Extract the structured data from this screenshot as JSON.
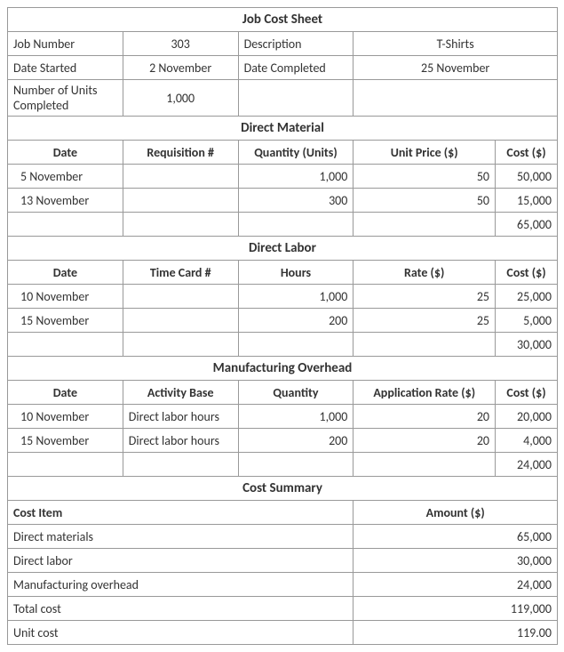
{
  "title": "Job Cost Sheet",
  "info": {
    "jobNumberLabel": "Job Number",
    "jobNumber": "303",
    "descriptionLabel": "Description",
    "description": "T-Shirts",
    "dateStartedLabel": "Date Started",
    "dateStarted": "2 November",
    "dateCompletedLabel": "Date Completed",
    "dateCompleted": "25 November",
    "unitsLabel": "Number of Units Completed",
    "units": "1,000"
  },
  "dm": {
    "heading": "Direct Material",
    "h": {
      "date": "Date",
      "req": "Requisition #",
      "qty": "Quantity (Units)",
      "price": "Unit  Price ($)",
      "cost": "Cost ($)"
    },
    "rows": [
      {
        "date": "5 November",
        "req": "",
        "qty": "1,000",
        "price": "50",
        "cost": "50,000"
      },
      {
        "date": "13 November",
        "req": "",
        "qty": "300",
        "price": "50",
        "cost": "15,000"
      }
    ],
    "total": {
      "cost": "65,000"
    }
  },
  "dl": {
    "heading": "Direct Labor",
    "h": {
      "date": "Date",
      "tc": "Time Card #",
      "hours": "Hours",
      "rate": "Rate ($)",
      "cost": "Cost ($)"
    },
    "rows": [
      {
        "date": "10 November",
        "tc": "",
        "hours": "1,000",
        "rate": "25",
        "cost": "25,000"
      },
      {
        "date": "15 November",
        "tc": "",
        "hours": "200",
        "rate": "25",
        "cost": "5,000"
      }
    ],
    "total": {
      "cost": "30,000"
    }
  },
  "moh": {
    "heading": "Manufacturing Overhead",
    "h": {
      "date": "Date",
      "base": "Activity Base",
      "qty": "Quantity",
      "rate": "Application Rate ($)",
      "cost": "Cost ($)"
    },
    "rows": [
      {
        "date": "10 November",
        "base": "Direct labor hours",
        "qty": "1,000",
        "rate": "20",
        "cost": "20,000"
      },
      {
        "date": "15 November",
        "base": "Direct labor hours",
        "qty": "200",
        "rate": "20",
        "cost": "4,000"
      }
    ],
    "total": {
      "cost": "24,000"
    }
  },
  "summary": {
    "heading": "Cost Summary",
    "h": {
      "item": "Cost Item",
      "amount": "Amount ($)"
    },
    "rows": [
      {
        "item": "Direct materials",
        "amount": "65,000"
      },
      {
        "item": "Direct labor",
        "amount": "30,000"
      },
      {
        "item": "Manufacturing overhead",
        "amount": "24,000"
      },
      {
        "item": "Total cost",
        "amount": "119,000"
      },
      {
        "item": "Unit cost",
        "amount": "119.00"
      }
    ]
  },
  "chart_data": {
    "type": "table",
    "title": "Job Cost Sheet",
    "job": {
      "number": 303,
      "description": "T-Shirts",
      "date_started": "2 November",
      "date_completed": "25 November",
      "units_completed": 1000
    },
    "sections": [
      {
        "name": "Direct Material",
        "columns": [
          "Date",
          "Requisition #",
          "Quantity (Units)",
          "Unit Price ($)",
          "Cost ($)"
        ],
        "rows": [
          [
            "5 November",
            null,
            1000,
            50,
            50000
          ],
          [
            "13 November",
            null,
            300,
            50,
            15000
          ]
        ],
        "total_cost": 65000
      },
      {
        "name": "Direct Labor",
        "columns": [
          "Date",
          "Time Card #",
          "Hours",
          "Rate ($)",
          "Cost ($)"
        ],
        "rows": [
          [
            "10 November",
            null,
            1000,
            25,
            25000
          ],
          [
            "15 November",
            null,
            200,
            25,
            5000
          ]
        ],
        "total_cost": 30000
      },
      {
        "name": "Manufacturing Overhead",
        "columns": [
          "Date",
          "Activity Base",
          "Quantity",
          "Application Rate ($)",
          "Cost ($)"
        ],
        "rows": [
          [
            "10 November",
            "Direct labor hours",
            1000,
            20,
            20000
          ],
          [
            "15 November",
            "Direct labor hours",
            200,
            20,
            4000
          ]
        ],
        "total_cost": 24000
      }
    ],
    "cost_summary": {
      "Direct materials": 65000,
      "Direct labor": 30000,
      "Manufacturing overhead": 24000,
      "Total cost": 119000,
      "Unit cost": 119.0
    }
  }
}
